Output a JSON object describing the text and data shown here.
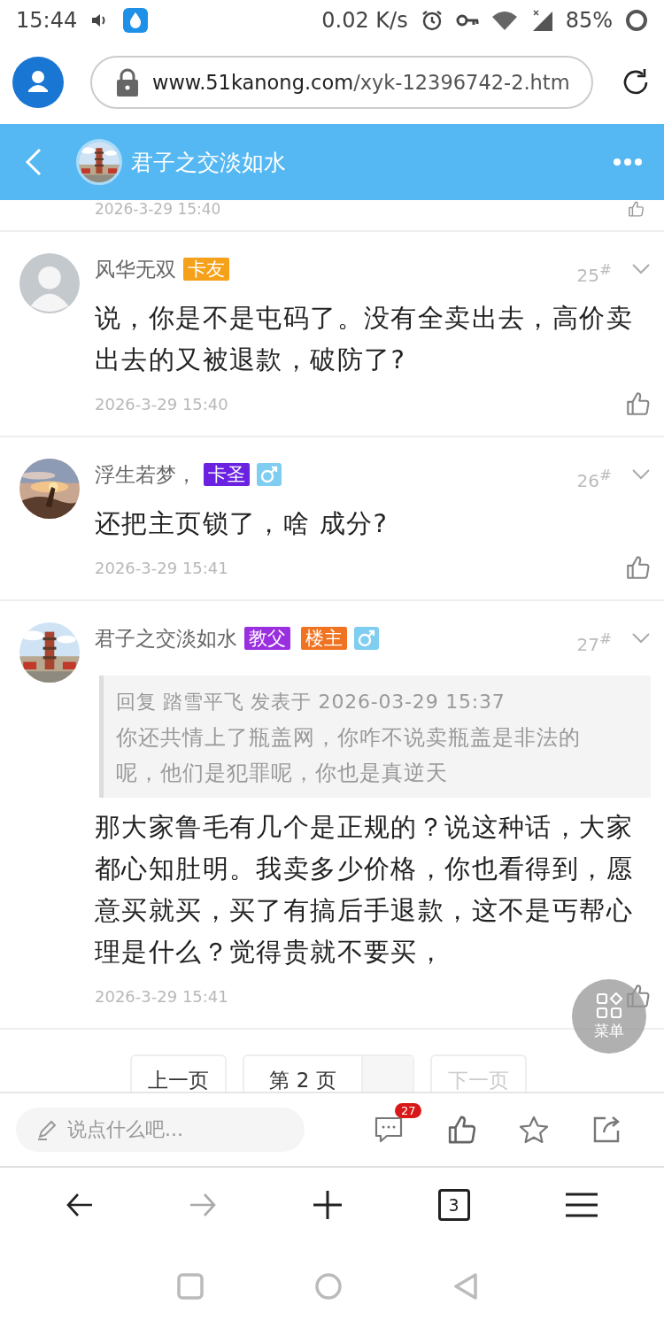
{
  "status_bar": {
    "time": "15:44",
    "speed": "0.02 K/s",
    "battery": "85%"
  },
  "browser": {
    "url_host": "www.51kanong.com",
    "url_path": "/xyk-12396742-2.htm"
  },
  "header": {
    "title": "君子之交淡如水",
    "avatar": {
      "kind": "picture"
    }
  },
  "previous_comment": {
    "time": "2026-3-29 15:40"
  },
  "comments": [
    {
      "author": "风华无双",
      "avatar": {
        "kind": "silhouette"
      },
      "badges": [
        {
          "text": "卡友",
          "color": "#f5a11a"
        }
      ],
      "male": false,
      "floor": "25$^{#}$",
      "body": "说，你是不是屯码了。没有全卖出去，高价卖出去的又被退款，破防了?",
      "time": "2026-3-29 15:40"
    },
    {
      "author": "浮生若梦，",
      "avatar": {
        "kind": "picture"
      },
      "badges": [
        {
          "text": "卡圣",
          "color": "#6a22e0"
        }
      ],
      "male": true,
      "floor": "26$^{#}$",
      "body": "还把主页锁了，啥 成分?",
      "time": "2026-3-29 15:41"
    },
    {
      "author": "君子之交淡如水",
      "avatar": {
        "kind": "picture"
      },
      "badges": [
        {
          "text": "教父",
          "color": "#9a2fe0"
        },
        {
          "text": "楼主",
          "color": "#f07322"
        }
      ],
      "male": true,
      "floor": "27$^{#}$",
      "quote": {
        "header": "回复 踏雪平飞 发表于 2026-03-29 15:37",
        "text": "你还共情上了瓶盖网，你咋不说卖瓶盖是非法的呢，他们是犯罪呢，你也是真逆天"
      },
      "body": "那大家鲁毛有几个是正规的？说这种话，大家都心知肚明。我卖多少价格，你也看得到，愿意买就买，买了有搞后手退款，这不是丐帮心理是什么？觉得贵就不要买，",
      "time": "2026-3-29 15:41"
    }
  ],
  "pager": {
    "prev": {
      "label": "上一页",
      "disabled": false
    },
    "current": "第 2 页",
    "next": {
      "label": "下一页",
      "disabled": true
    }
  },
  "float_menu": {
    "label": "菜单"
  },
  "action_bar": {
    "placeholder": "说点什么吧...",
    "comment_count": "27"
  },
  "browser_nav": {
    "forward_disabled": true,
    "tab_count": "3"
  }
}
